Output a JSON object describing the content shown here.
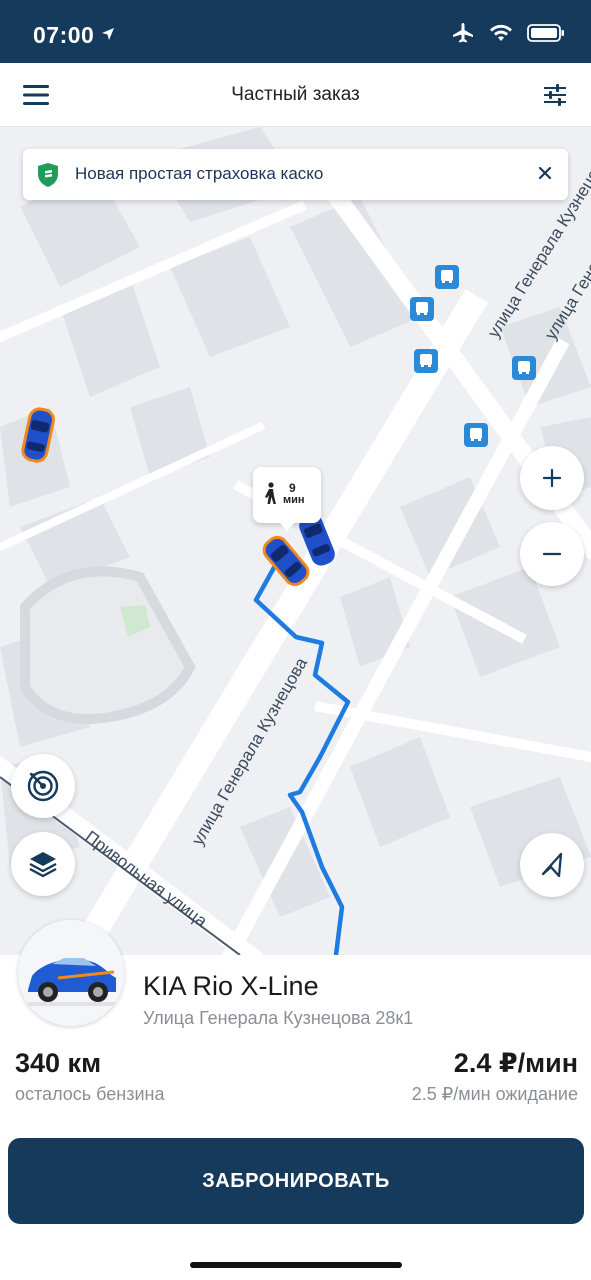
{
  "status_bar": {
    "time": "07:00",
    "icons": [
      "location-arrow-icon",
      "airplane-icon",
      "wifi-icon",
      "battery-icon"
    ]
  },
  "nav": {
    "title": "Частный заказ",
    "left_icon": "hamburger-menu-icon",
    "right_icon": "filter-sliders-icon"
  },
  "banner": {
    "text": "Новая простая страховка каско",
    "icon": "shield-icon",
    "close_icon": "close-icon"
  },
  "map": {
    "streets": [
      "улица Генерала Кузнецова",
      "улица Генерала Кузнецова",
      "улица Генерала Кузнецова",
      "Привольная улица"
    ],
    "walk_time": {
      "value": "9",
      "unit": "мин"
    },
    "controls": [
      "zoom-in-icon",
      "zoom-out-icon",
      "radar-icon",
      "layers-icon",
      "navigation-arrow-icon"
    ]
  },
  "car": {
    "name": "KIA Rio X-Line",
    "address": "Улица Генерала Кузнецова 28к1",
    "fuel_value": "340 км",
    "fuel_label": "осталось бензина",
    "price": "2.4 ₽/мин",
    "price_wait": "2.5 ₽/мин ожидание"
  },
  "actions": {
    "book_label": "ЗАБРОНИРОВАТЬ"
  },
  "colors": {
    "brand": "#163a5c",
    "route": "#1e7be0",
    "car_blue": "#1f4fc9",
    "car_orange": "#f08a1c",
    "bus_stop": "#2a8ad8"
  }
}
